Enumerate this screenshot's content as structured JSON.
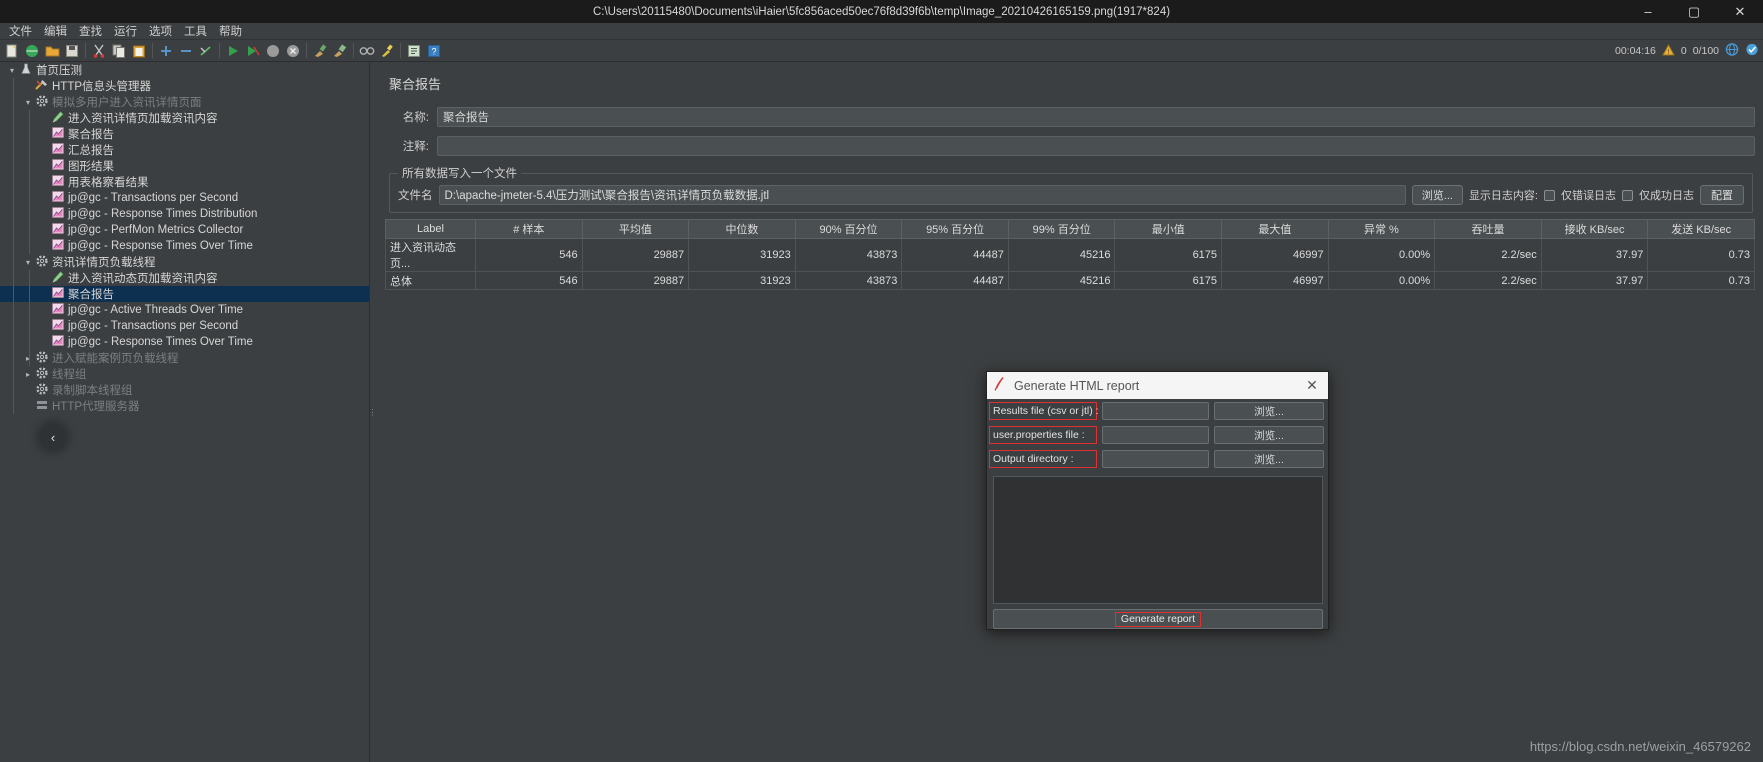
{
  "window": {
    "title": "C:\\Users\\20115480\\Documents\\iHaier\\5fc856aced50ec76f8d39f6b\\temp\\Image_20210426165159.png(1917*824)",
    "minimize": "–",
    "maximize": "▢",
    "close": "✕"
  },
  "menubar": [
    "文件",
    "编辑",
    "查找",
    "运行",
    "选项",
    "工具",
    "帮助"
  ],
  "toolbar": {
    "icons": [
      "new-icon",
      "templates-icon",
      "open-icon",
      "save-icon",
      "cut-icon",
      "copy-icon",
      "paste-icon",
      "expand-icon",
      "collapse-icon",
      "toggle-icon",
      "start-icon",
      "start-no-pauses-icon",
      "stop-icon",
      "shutdown-icon",
      "clear-icon",
      "clear-all-icon",
      "search-icon",
      "search-reset-icon",
      "function-helper-icon",
      "help-icon"
    ],
    "timer": "00:04:16",
    "warn_icon": "warning-icon",
    "warn_count": "0",
    "threads": "0/100",
    "remote_icon": "globe-icon",
    "status_icon": "status-icon"
  },
  "tree": {
    "items": [
      {
        "label": "首页压测",
        "icon": "test-plan-icon",
        "indent": 0,
        "twisty": "▾",
        "state": "normal"
      },
      {
        "label": "HTTP信息头管理器",
        "icon": "header-manager-icon",
        "indent": 1,
        "twisty": "",
        "state": "normal"
      },
      {
        "label": "模拟多用户进入资讯详情页面",
        "icon": "thread-group-icon",
        "indent": 1,
        "twisty": "▾",
        "state": "disabled"
      },
      {
        "label": "进入资讯详情页加载资讯内容",
        "icon": "http-request-icon",
        "indent": 2,
        "twisty": "",
        "state": "normal"
      },
      {
        "label": "聚合报告",
        "icon": "listener-icon",
        "indent": 2,
        "twisty": "",
        "state": "normal"
      },
      {
        "label": "汇总报告",
        "icon": "listener-icon",
        "indent": 2,
        "twisty": "",
        "state": "normal"
      },
      {
        "label": "图形结果",
        "icon": "listener-icon",
        "indent": 2,
        "twisty": "",
        "state": "normal"
      },
      {
        "label": "用表格察看结果",
        "icon": "listener-icon",
        "indent": 2,
        "twisty": "",
        "state": "normal"
      },
      {
        "label": "jp@gc - Transactions per Second",
        "icon": "listener-icon",
        "indent": 2,
        "twisty": "",
        "state": "normal"
      },
      {
        "label": "jp@gc - Response Times Distribution",
        "icon": "listener-icon",
        "indent": 2,
        "twisty": "",
        "state": "normal"
      },
      {
        "label": "jp@gc - PerfMon Metrics Collector",
        "icon": "listener-icon",
        "indent": 2,
        "twisty": "",
        "state": "normal"
      },
      {
        "label": "jp@gc - Response Times Over Time",
        "icon": "listener-icon",
        "indent": 2,
        "twisty": "",
        "state": "normal"
      },
      {
        "label": "资讯详情页负载线程",
        "icon": "thread-group-icon",
        "indent": 1,
        "twisty": "▾",
        "state": "normal"
      },
      {
        "label": "进入资讯动态页加载资讯内容",
        "icon": "http-request-icon",
        "indent": 2,
        "twisty": "",
        "state": "normal"
      },
      {
        "label": "聚合报告",
        "icon": "listener-icon",
        "indent": 2,
        "twisty": "",
        "state": "selected"
      },
      {
        "label": "jp@gc - Active Threads Over Time",
        "icon": "listener-icon",
        "indent": 2,
        "twisty": "",
        "state": "normal"
      },
      {
        "label": "jp@gc - Transactions per Second",
        "icon": "listener-icon",
        "indent": 2,
        "twisty": "",
        "state": "normal"
      },
      {
        "label": "jp@gc - Response Times Over Time",
        "icon": "listener-icon",
        "indent": 2,
        "twisty": "",
        "state": "normal"
      },
      {
        "label": "进入赋能案例页负载线程",
        "icon": "thread-group-icon",
        "indent": 1,
        "twisty": "▸",
        "state": "disabled"
      },
      {
        "label": "线程组",
        "icon": "thread-group-icon",
        "indent": 1,
        "twisty": "▸",
        "state": "disabled"
      },
      {
        "label": "录制脚本线程组",
        "icon": "thread-group-icon",
        "indent": 1,
        "twisty": "",
        "state": "disabled"
      },
      {
        "label": "HTTP代理服务器",
        "icon": "proxy-server-icon",
        "indent": 1,
        "twisty": "",
        "state": "disabled"
      }
    ],
    "collapse_chevron": "‹"
  },
  "panel": {
    "title": "聚合报告",
    "name_label": "名称:",
    "name_value": "聚合报告",
    "comment_label": "注释:",
    "comment_value": "",
    "group_legend": "所有数据写入一个文件",
    "filename_label": "文件名",
    "filename_value": "D:\\apache-jmeter-5.4\\压力测试\\聚合报告\\资讯详情页负载数据.jtl",
    "browse_label": "浏览...",
    "log_display_label": "显示日志内容:",
    "only_errors_label": "仅错误日志",
    "only_success_label": "仅成功日志",
    "config_label": "配置"
  },
  "table": {
    "headers": [
      "Label",
      "# 样本",
      "平均值",
      "中位数",
      "90% 百分位",
      "95% 百分位",
      "99% 百分位",
      "最小值",
      "最大值",
      "异常 %",
      "吞吐量",
      "接收 KB/sec",
      "发送 KB/sec"
    ],
    "rows": [
      [
        "进入资讯动态页...",
        "546",
        "29887",
        "31923",
        "43873",
        "44487",
        "45216",
        "6175",
        "46997",
        "0.00%",
        "2.2/sec",
        "37.97",
        "0.73"
      ],
      [
        "总体",
        "546",
        "29887",
        "31923",
        "43873",
        "44487",
        "45216",
        "6175",
        "46997",
        "0.00%",
        "2.2/sec",
        "37.97",
        "0.73"
      ]
    ]
  },
  "dialog": {
    "icon": "jmeter-feather-icon",
    "title": "Generate HTML report",
    "close": "✕",
    "fields": [
      {
        "label": "Results file (csv or jtl) :",
        "value": "",
        "button": "浏览..."
      },
      {
        "label": "user.properties file :",
        "value": "",
        "button": "浏览..."
      },
      {
        "label": "Output directory :",
        "value": "",
        "button": "浏览..."
      }
    ],
    "console_text": "",
    "generate_label": "Generate report",
    "highlight_color": "#e03030"
  },
  "watermark": "https://blog.csdn.net/weixin_46579262"
}
